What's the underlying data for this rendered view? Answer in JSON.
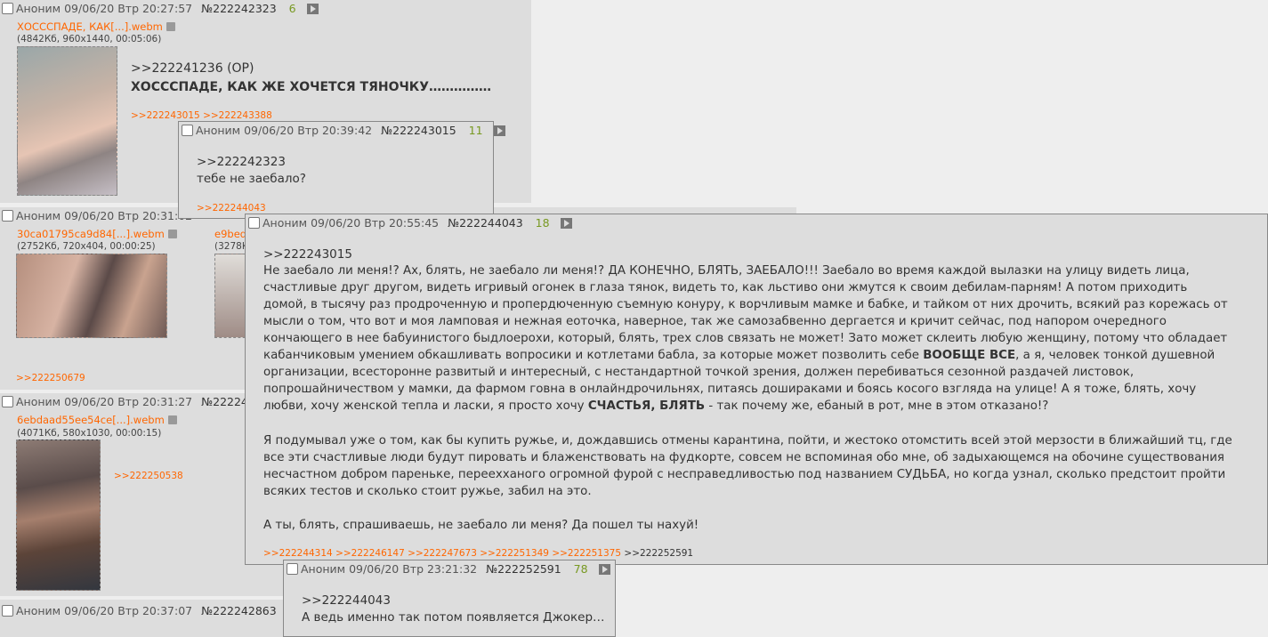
{
  "posts": {
    "p1": {
      "author": "Аноним",
      "date": "09/06/20 Втр 20:27:57",
      "num": "№222242323",
      "count": "6",
      "file": {
        "name": "ХОСССПАДЕ, КАК[...].webm",
        "info": "(4842Кб, 960x1440, 00:05:06)"
      },
      "reply_to": ">>222241236 (OP)",
      "text": "ХОСССПАДЕ, КАК ЖЕ ХОЧЕТСЯ ТЯНОЧКУ……………",
      "replies": [
        ">>222243015",
        ">>222243388"
      ]
    },
    "p2": {
      "author": "Аноним",
      "date": "09/06/20 Втр 20:31:02",
      "files": [
        {
          "name": "30ca01795ca9d84[...].webm",
          "info": "(2752Кб, 720x404, 00:00:25)"
        },
        {
          "name": "e9bed",
          "info": "(3278К"
        }
      ],
      "replies": [
        ">>222250679"
      ]
    },
    "p3": {
      "author": "Аноним",
      "date": "09/06/20 Втр 20:31:27",
      "num": "№2222425",
      "file": {
        "name": "6ebdaad55ee54ce[...].webm",
        "info": "(4071Кб, 580x1030, 00:00:15)"
      },
      "replies": [
        ">>222250538"
      ]
    },
    "p4": {
      "author": "Аноним",
      "date": "09/06/20 Втр 20:37:07",
      "num": "№222242863",
      "count": "9"
    },
    "pop1": {
      "author": "Аноним",
      "date": "09/06/20 Втр 20:39:42",
      "num": "№222243015",
      "count": "11",
      "reply_to": ">>222242323",
      "text": "тебе не заебало?",
      "replies": [
        ">>222244043"
      ]
    },
    "pop2": {
      "author": "Аноним",
      "date": "09/06/20 Втр 20:55:45",
      "num": "№222244043",
      "count": "18",
      "reply_to": ">>222243015",
      "para1_a": "Не заебало ли меня!? Ах, блять, не заебало ли меня!? ДА КОНЕЧНО, БЛЯТЬ, ЗАЕБАЛО!!! Заебало во время каждой вылазки на улицу видеть лица, счастливые друг другом, видеть игривый огонек в глаза тянок, видеть то, как льстиво они жмутся к своим дебилам-парням! А потом приходить домой, в тысячу раз продроченную и пропердюченную съемную конуру, к ворчливым мамке и бабке, и тайком от них дрочить, всякий раз корежась от мысли о том, что вот и моя ламповая и нежная еоточка, наверное, так же самозабвенно дергается и кричит сейчас, под напором очередного кончающего в нее бабуинистого быдлоерохи, который, блять, трех слов связать не может! Зато может склеить любую женщину, потому что обладает кабанчиковым умением обкашливать вопросики и котлетами бабла, за которые может позволить себе ",
      "para1_b": "ВООБЩЕ ВСЕ",
      "para1_c": ", а я, человек тонкой душевной организации, всесторонне развитый и интересный, с нестандартной точкой зрения, должен перебиваться сезонной раздачей листовок, попрошайничеством у мамки, да фармом говна в онлайндрочильнях, питаясь дошираками и боясь косого взгляда на улице! А я тоже, блять, хочу любви, хочу женской тепла и ласки, я просто хочу ",
      "para1_d": "СЧАСТЬЯ, БЛЯТЬ",
      "para1_e": " - так почему же, ебаный в рот, мне в этом отказано!?",
      "para2": "Я подумывал уже о том, как бы купить ружье, и, дождавшись отмены карантина, пойти, и жестоко отомстить всей этой мерзости в ближайший тц, где все эти счастливые люди будут пировать и блаженствовать на фудкорте, совсем не вспоминая обо мне, об задыхающемся на обочине существования несчастном добром пареньке, переехханого огромной фурой с несправедливостью под названием СУДЬБА, но когда узнал, сколько предстоит пройти всяких тестов и сколько стоит ружье, забил на это.",
      "para3": "А ты, блять, спрашиваешь, не заебало ли меня? Да пошел ты нахуй!",
      "replies": [
        ">>222244314",
        ">>222246147",
        ">>222247673",
        ">>222251349",
        ">>222251375"
      ],
      "own_reply": ">>222252591"
    },
    "pop3": {
      "author": "Аноним",
      "date": "09/06/20 Втр 23:21:32",
      "num": "№222252591",
      "count": "78",
      "reply_to": ">>222244043",
      "text": "А ведь именно так потом появляется Джокер…"
    }
  }
}
